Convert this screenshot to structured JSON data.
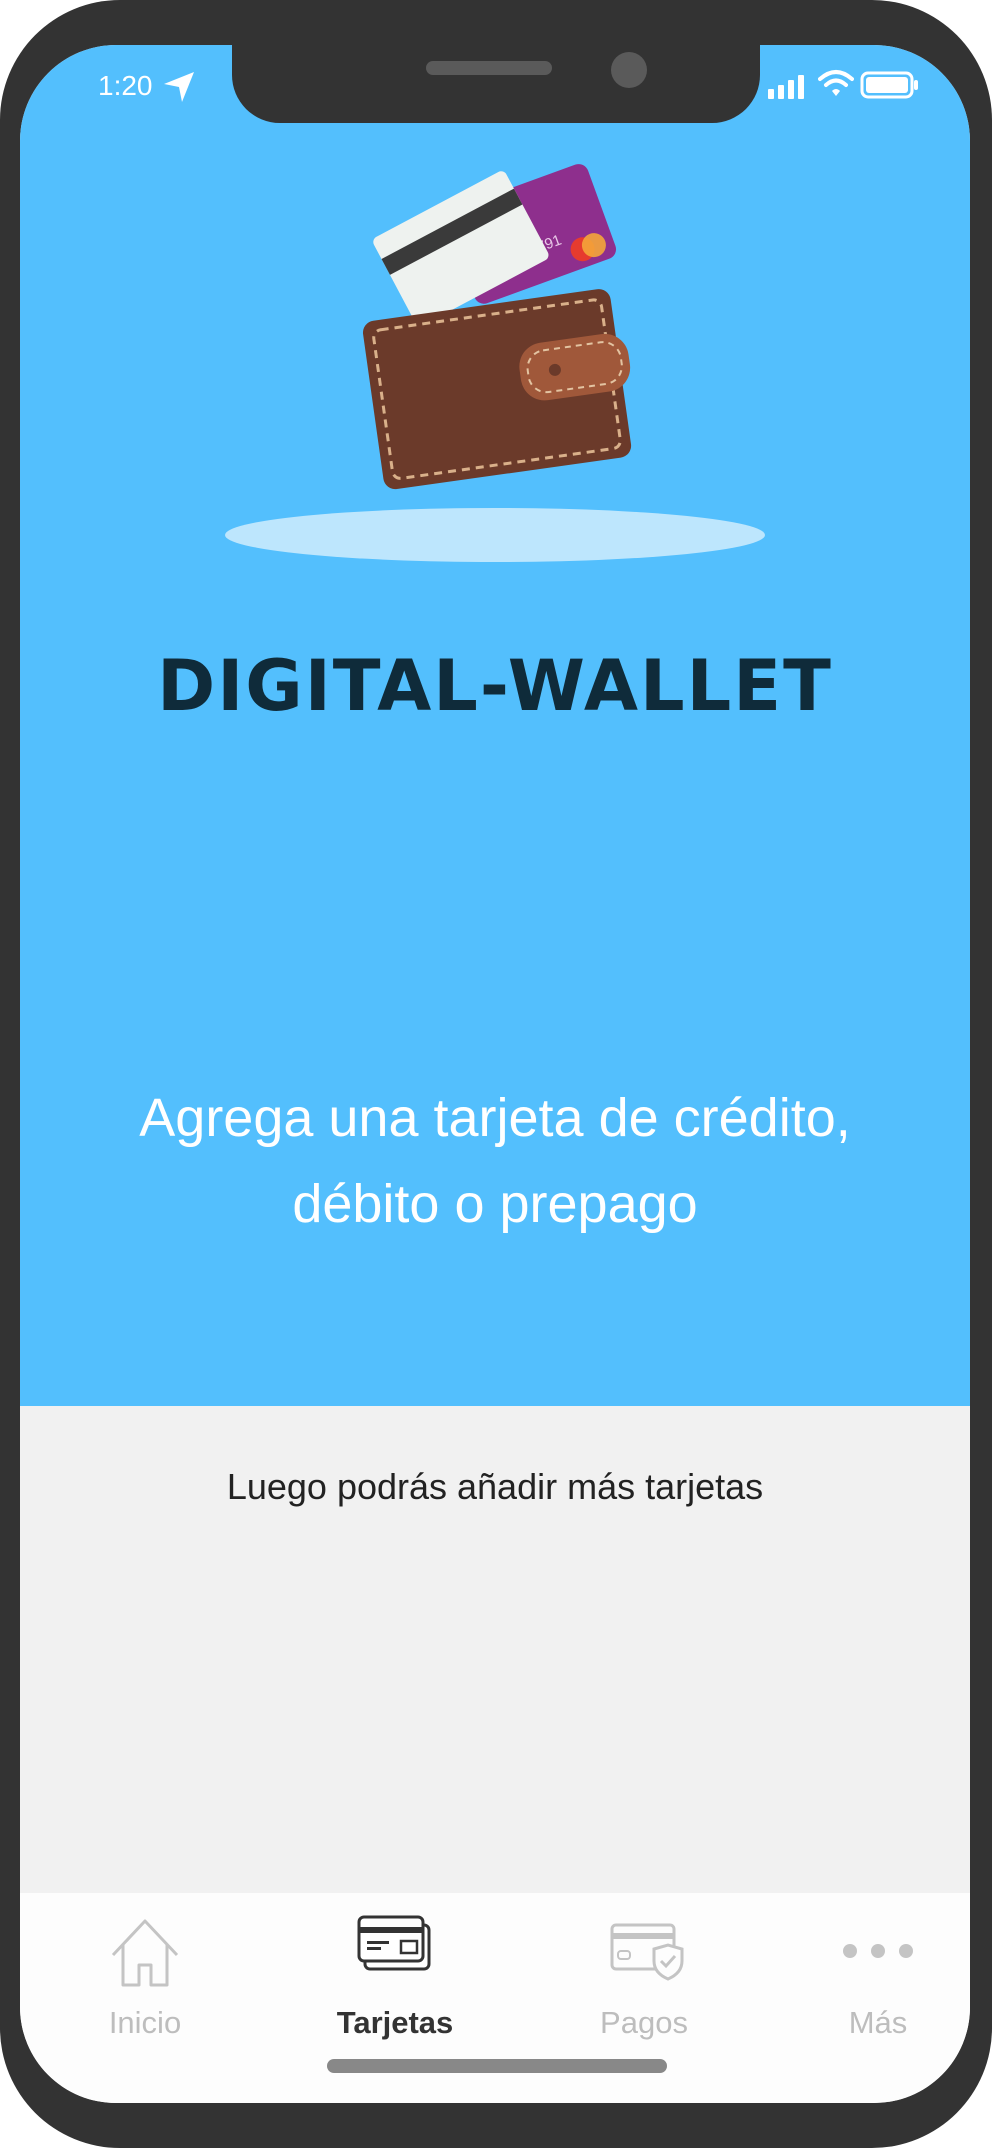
{
  "status_bar": {
    "time": "1:20",
    "icons": [
      "location-arrow-icon",
      "signal-icon",
      "wifi-icon",
      "battery-icon"
    ]
  },
  "hero": {
    "illustration": "wallet-with-cards-icon",
    "card_text": "0007 6791",
    "title": "DIGITAL-WALLET",
    "headline": "Agrega una tarjeta de crédito, débito o prepago"
  },
  "body": {
    "subtitle": "Luego podrás añadir más tarjetas"
  },
  "tab_bar": {
    "tabs": [
      {
        "label": "Inicio",
        "icon": "home-icon",
        "active": false
      },
      {
        "label": "Tarjetas",
        "icon": "cards-icon",
        "active": true
      },
      {
        "label": "Pagos",
        "icon": "secure-payment-icon",
        "active": false
      },
      {
        "label": "Más",
        "icon": "more-dots-icon",
        "active": false
      }
    ]
  },
  "colors": {
    "hero_background": "#53bffd",
    "body_background": "#f1f1f1",
    "title": "#0f2b3a",
    "tab_inactive": "#bdbdbd",
    "tab_active": "#333333"
  }
}
